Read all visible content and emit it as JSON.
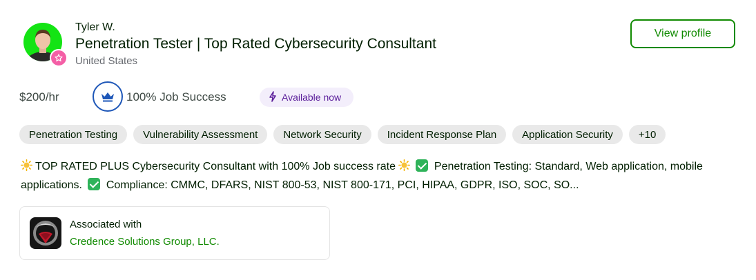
{
  "profile": {
    "name": "Tyler W.",
    "title": "Penetration Tester | Top Rated Cybersecurity Consultant",
    "location": "United States",
    "view_profile_label": "View profile",
    "rate": "$200/hr",
    "job_success": "100% Job Success",
    "availability": "Available now"
  },
  "skills": [
    "Penetration Testing",
    "Vulnerability Assessment",
    "Network Security",
    "Incident Response Plan",
    "Application Security",
    "+10"
  ],
  "description": {
    "part1": "TOP RATED PLUS Cybersecurity Consultant with 100% Job success rate",
    "part2": "Penetration Testing: Standard, Web application, mobile applications.",
    "part3": "Compliance: CMMC, DFARS, NIST 800-53, NIST 800-171, PCI, HIPAA, GDPR, ISO, SOC, SO..."
  },
  "association": {
    "label": "Associated with",
    "company": "Credence Solutions Group, LLC."
  },
  "colors": {
    "accent_green": "#108a00",
    "avatar_bg": "#14e414",
    "badge_pink": "#f45fa6",
    "jss_blue": "#1e57b8",
    "available_purple": "#5a1d9a"
  },
  "icons": {
    "badge": "top-rated-plus-star-icon",
    "job_success": "crown-icon",
    "availability": "lightning-bolt-icon",
    "emoji1": "sun-emoji-icon",
    "emoji2": "check-mark-emoji-icon"
  }
}
